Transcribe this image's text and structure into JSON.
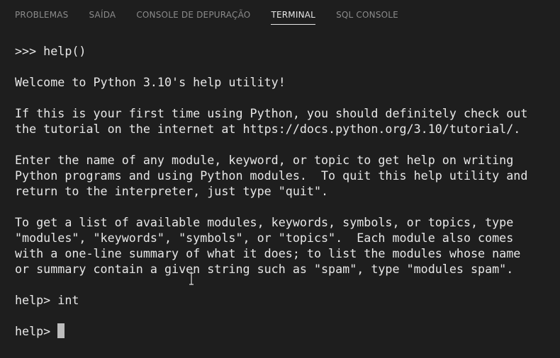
{
  "tabs": [
    {
      "label": "PROBLEMAS",
      "active": false
    },
    {
      "label": "SAÍDA",
      "active": false
    },
    {
      "label": "CONSOLE DE DEPURAÇÃO",
      "active": false
    },
    {
      "label": "TERMINAL",
      "active": true
    },
    {
      "label": "SQL CONSOLE",
      "active": false
    }
  ],
  "terminal": {
    "lines": [
      ">>> help()",
      "",
      "Welcome to Python 3.10's help utility!",
      "",
      "If this is your first time using Python, you should definitely check out",
      "the tutorial on the internet at https://docs.python.org/3.10/tutorial/.",
      "",
      "Enter the name of any module, keyword, or topic to get help on writing",
      "Python programs and using Python modules.  To quit this help utility and",
      "return to the interpreter, just type \"quit\".",
      "",
      "To get a list of available modules, keywords, symbols, or topics, type",
      "\"modules\", \"keywords\", \"symbols\", or \"topics\".  Each module also comes",
      "with a one-line summary of what it does; to list the modules whose name",
      "or summary contain a given string such as \"spam\", type \"modules spam\".",
      "",
      "help> int",
      ""
    ],
    "prompt": "help> "
  },
  "colors": {
    "background": "#1e1e1e",
    "text": "#e8e8e8",
    "tab_inactive": "#8b8b8b",
    "tab_active": "#e7e7e7"
  }
}
